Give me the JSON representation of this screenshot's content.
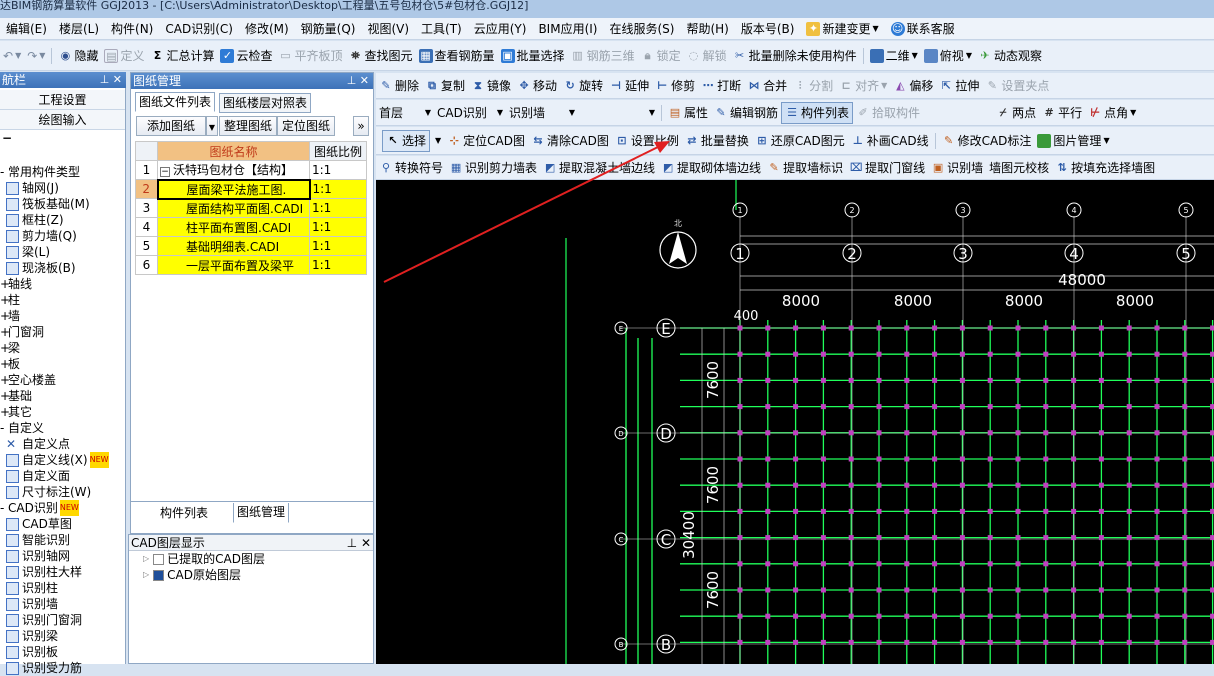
{
  "window": {
    "title": "达BIM钢筋算量软件 GGJ2013 - [C:\\Users\\Administrator\\Desktop\\工程量\\五号包材仓\\5#包材仓.GGJ12]"
  },
  "menu": [
    "编辑(E)",
    "楼层(L)",
    "构件(N)",
    "CAD识别(C)",
    "修改(M)",
    "钢筋量(Q)",
    "视图(V)",
    "工具(T)",
    "云应用(Y)",
    "BIM应用(I)",
    "在线服务(S)",
    "帮助(H)",
    "版本号(B)",
    "新建变更",
    "联系客服"
  ],
  "toolbar1": [
    "隐藏",
    "定义",
    "汇总计算",
    "云检查",
    "平齐板顶",
    "查找图元",
    "查看钢筋量",
    "批量选择",
    "钢筋三维",
    "锁定",
    "解锁",
    "批量删除未使用构件",
    "二维",
    "俯视",
    "动态观察"
  ],
  "nav": {
    "title": "航栏",
    "buttons": [
      "工程设置",
      "绘图输入"
    ],
    "tree": [
      "常用构件类型",
      "轴网(J)",
      "筏板基础(M)",
      "框柱(Z)",
      "剪力墙(Q)",
      "梁(L)",
      "现浇板(B)",
      "轴线",
      "柱",
      "墙",
      "门窗洞",
      "梁",
      "板",
      "空心楼盖",
      "基础",
      "其它",
      "自定义",
      "自定义点",
      "自定义线(X)",
      "自定义面",
      "尺寸标注(W)",
      "CAD识别",
      "CAD草图",
      "智能识别",
      "识别轴网",
      "识别柱大样",
      "识别柱",
      "识别墙",
      "识别门窗洞",
      "识别梁",
      "识别板",
      "识别受力筋"
    ],
    "new_badge": "NEW"
  },
  "drawing_panel": {
    "title": "图纸管理",
    "tabs": [
      "图纸文件列表",
      "图纸楼层对照表"
    ],
    "buttons": [
      "添加图纸",
      "整理图纸",
      "定位图纸"
    ],
    "headers": [
      "图纸名称",
      "图纸比例"
    ],
    "rows": [
      {
        "num": "1",
        "name": "沃特玛包材仓【结构】",
        "scale": "1:1"
      },
      {
        "num": "2",
        "name": "屋面梁平法施工图.",
        "scale": "1:1"
      },
      {
        "num": "3",
        "name": "屋面结构平面图.CADI",
        "scale": "1:1"
      },
      {
        "num": "4",
        "name": "柱平面布置图.CADI",
        "scale": "1:1"
      },
      {
        "num": "5",
        "name": "基础明细表.CADI",
        "scale": "1:1"
      },
      {
        "num": "6",
        "name": "一层平面布置及梁平",
        "scale": "1:1"
      }
    ],
    "bottom_tabs": [
      "构件列表",
      "图纸管理"
    ]
  },
  "cad_layer": {
    "title": "CAD图层显示",
    "items": [
      "已提取的CAD图层",
      "CAD原始图层"
    ]
  },
  "edit_toolbar": [
    "删除",
    "复制",
    "镜像",
    "移动",
    "旋转",
    "延伸",
    "修剪",
    "打断",
    "合并",
    "分割",
    "对齐",
    "偏移",
    "拉伸",
    "设置夹点"
  ],
  "selector_bar": {
    "floor": "首层",
    "category": "CAD识别",
    "subtype": "识别墙",
    "attr": "属性",
    "edit_rebar": "编辑钢筋",
    "component_list": "构件列表",
    "pick": "拾取构件",
    "two_point": "两点",
    "parallel": "平行",
    "point_angle": "点角"
  },
  "cad_toolbar": [
    "选择",
    "定位CAD图",
    "清除CAD图",
    "设置比例",
    "批量替换",
    "还原CAD图元",
    "补画CAD线",
    "修改CAD标注",
    "图片管理"
  ],
  "wall_toolbar": [
    "转换符号",
    "识别剪力墙表",
    "提取混凝土墙边线",
    "提取砌体墙边线",
    "提取墙标识",
    "提取门窗线",
    "识别墙",
    "墙图元校核",
    "按填充选择墙图"
  ],
  "drawing": {
    "axes_top": [
      "1",
      "2",
      "3",
      "4",
      "5"
    ],
    "axes_left": [
      "E",
      "D",
      "C",
      "B"
    ],
    "dims_top": [
      "8000",
      "8000",
      "8000",
      "8000"
    ],
    "total_top": "48000",
    "dims_left": [
      "7600",
      "7600",
      "7600"
    ],
    "total_left": "30400",
    "left_small": "400",
    "north": "北"
  }
}
